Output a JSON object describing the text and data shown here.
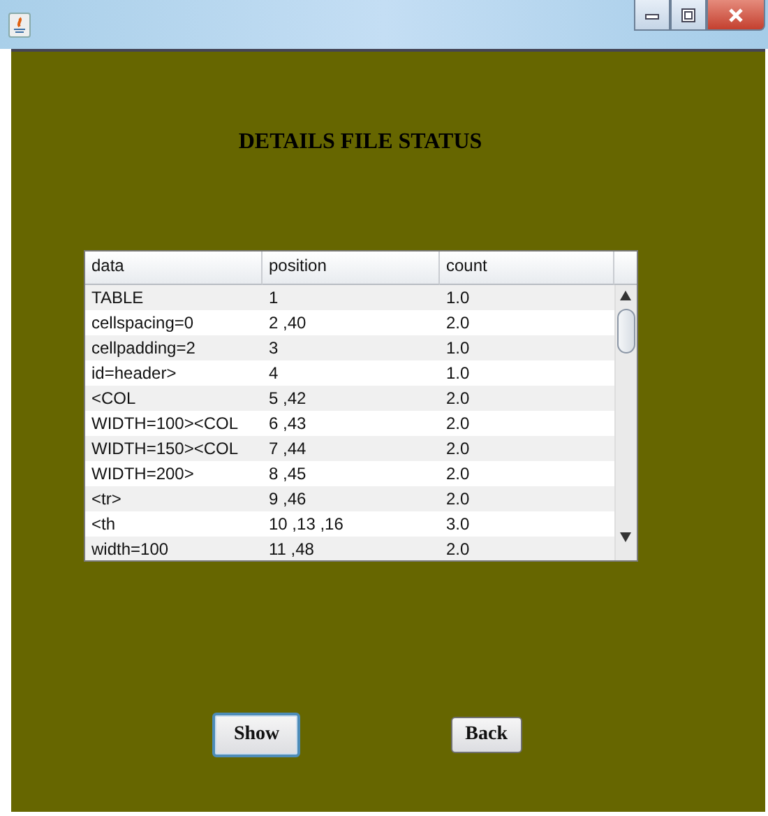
{
  "heading": "DETAILS FILE STATUS",
  "table": {
    "columns": [
      "data",
      "position",
      "count"
    ],
    "rows": [
      [
        "TABLE",
        "1",
        "1.0"
      ],
      [
        "cellspacing=0",
        "2 ,40",
        "2.0"
      ],
      [
        "cellpadding=2",
        "3",
        "1.0"
      ],
      [
        "id=header>",
        "4",
        "1.0"
      ],
      [
        "<COL",
        "5 ,42",
        "2.0"
      ],
      [
        "WIDTH=100><COL",
        "6 ,43",
        "2.0"
      ],
      [
        "WIDTH=150><COL",
        "7 ,44",
        "2.0"
      ],
      [
        "WIDTH=200>",
        "8 ,45",
        "2.0"
      ],
      [
        "<tr>",
        "9 ,46",
        "2.0"
      ],
      [
        "<th",
        "10 ,13 ,16",
        "3.0"
      ],
      [
        "width=100",
        "11 ,48",
        "2.0"
      ]
    ]
  },
  "buttons": [
    {
      "label": "Show",
      "focused": true
    },
    {
      "label": "Back",
      "focused": false
    }
  ]
}
